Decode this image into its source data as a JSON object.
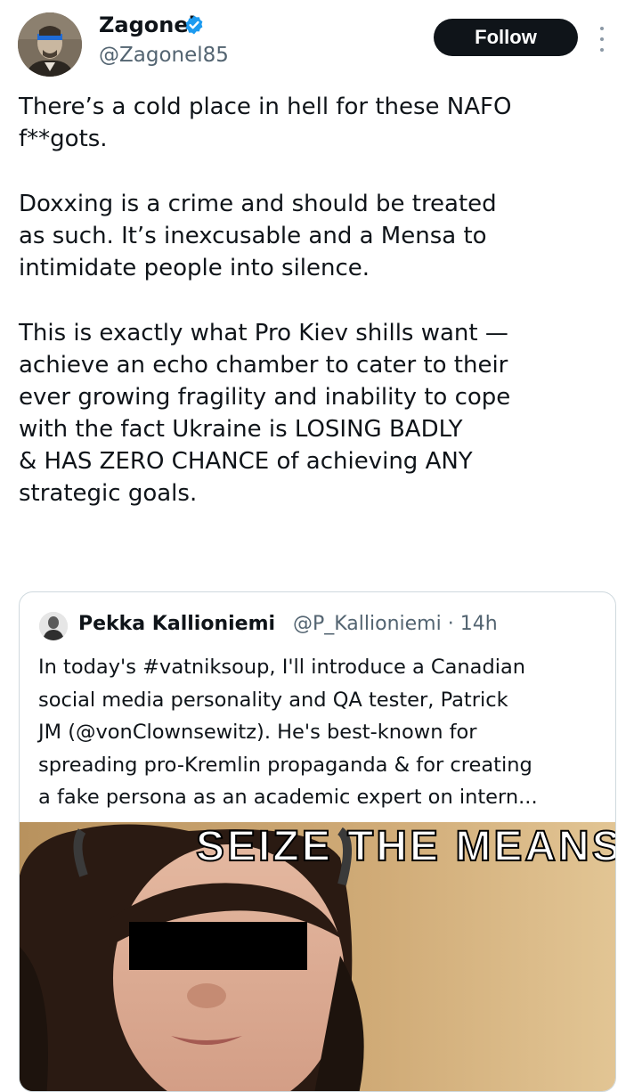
{
  "author": {
    "display_name": "Zagonel",
    "handle": "@Zagonel85",
    "avatar_icon": "portrait-avatar",
    "verified_icon": "verified-badge-icon",
    "verified_color": "#1d9bf0"
  },
  "actions": {
    "follow_label": "Follow",
    "more_icon": "vertical-ellipsis-icon"
  },
  "tweet": {
    "paragraphs": [
      "There’s a cold place in hell for these NAFO\nf**gots.",
      "Doxxing is a crime and should be treated\nas such. It’s inexcusable and a Mensa to\nintimidate people into silence.",
      "This is exactly what Pro Kiev shills want —\nachieve an echo chamber to cater to their\never growing fragility and inability to cope\nwith the fact Ukraine is LOSING BADLY\n& HAS ZERO CHANCE of achieving ANY\nstrategic goals."
    ]
  },
  "quote": {
    "display_name": "Pekka Kallioniemi",
    "handle_time": "@P_Kallioniemi · 14h",
    "text": "In today's #vatniksoup, I'll introduce a Canadian\nsocial media personality and QA tester, Patrick\nJM (@vonClownsewitz). He's best-known for\nspreading pro-Kremlin propaganda & for creating\na fake persona as an academic expert on intern...",
    "media_caption": "SEIZE THE MEANS OF",
    "media_icon": "photo-with-censor-bar"
  },
  "colors": {
    "text_primary": "#0f1419",
    "text_secondary": "#536471",
    "border": "#cfd9de",
    "follow_bg": "#0f1419"
  }
}
